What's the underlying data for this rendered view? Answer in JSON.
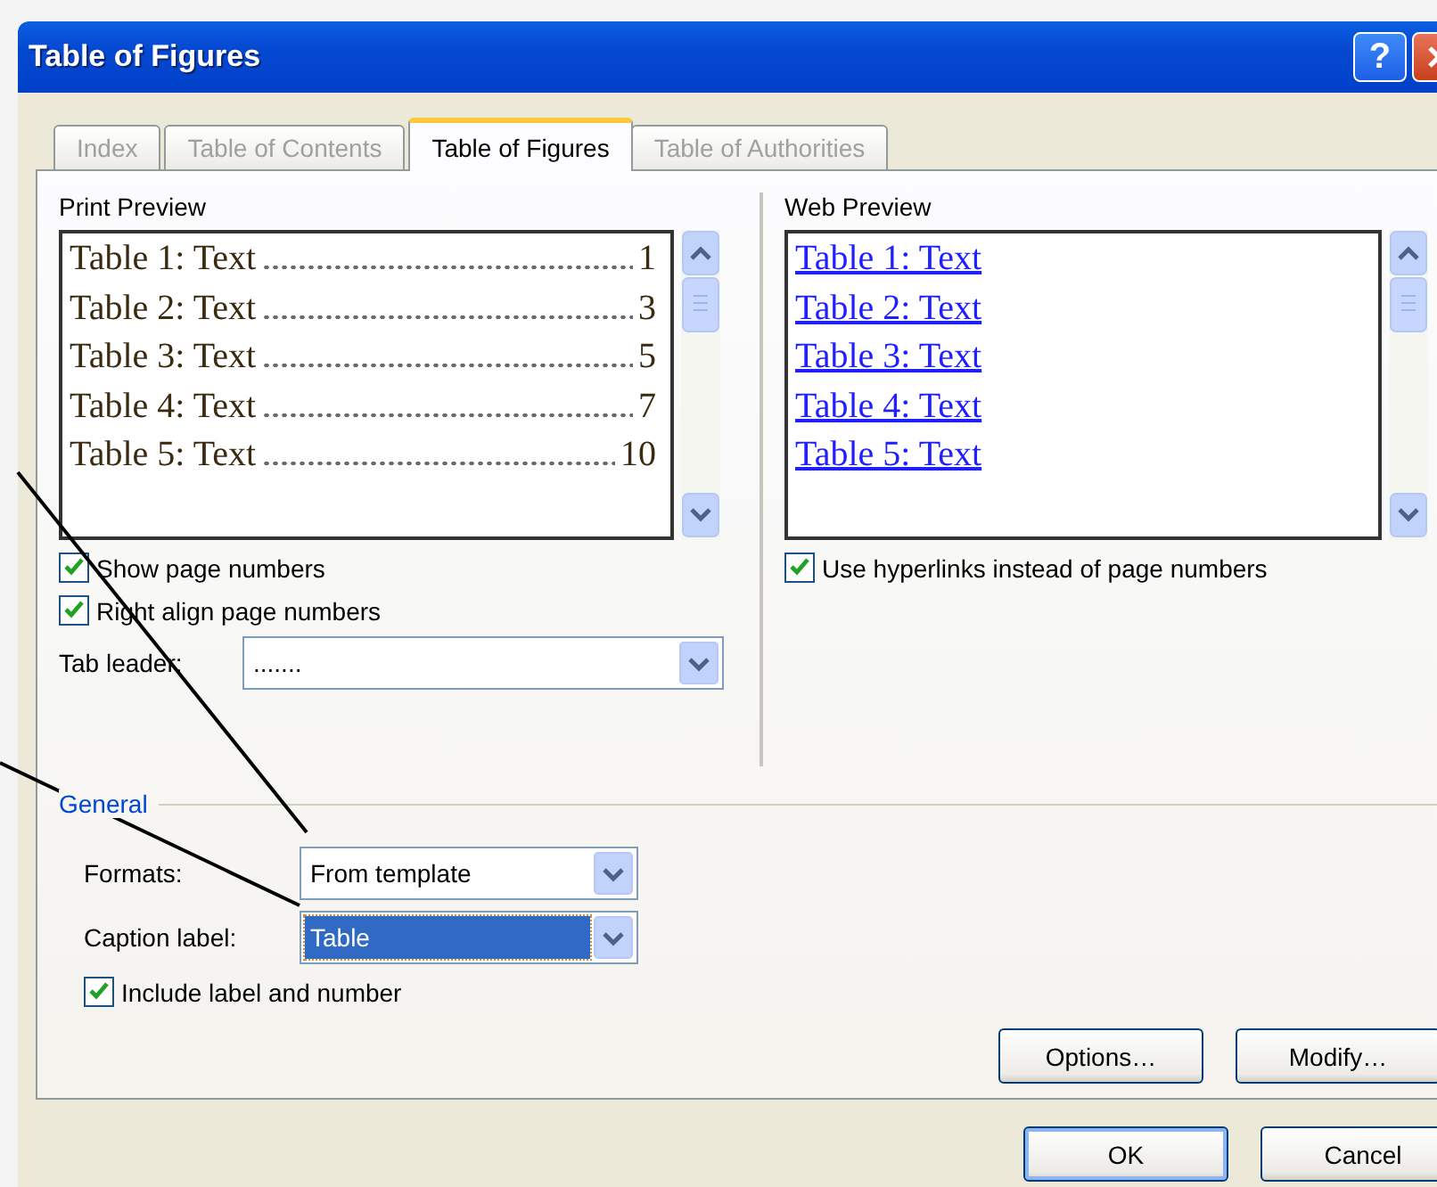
{
  "window": {
    "title": "Table of Figures",
    "help": "?"
  },
  "tabs": [
    {
      "label": "Index",
      "selected": false
    },
    {
      "label": "Table of Contents",
      "selected": false
    },
    {
      "label": "Table of Figures",
      "selected": true
    },
    {
      "label": "Table of Authorities",
      "selected": false
    }
  ],
  "print_preview": {
    "label": "Print Preview",
    "entries": [
      {
        "text": "Table 1: Text",
        "page": "1"
      },
      {
        "text": "Table 2: Text",
        "page": "3"
      },
      {
        "text": "Table 3: Text",
        "page": "5"
      },
      {
        "text": "Table 4: Text",
        "page": "7"
      },
      {
        "text": "Table 5: Text",
        "page": "10"
      }
    ]
  },
  "print_options": [
    {
      "label": "Show page numbers",
      "checked": true
    },
    {
      "label": "Right align page numbers",
      "checked": true
    }
  ],
  "tab_leader": {
    "label": "Tab leader:",
    "value": "......."
  },
  "web_preview": {
    "label": "Web Preview",
    "entries": [
      "Table 1: Text",
      "Table 2: Text",
      "Table 3: Text",
      "Table 4: Text",
      "Table 5: Text"
    ]
  },
  "web_options": [
    {
      "label": "Use hyperlinks instead of page numbers",
      "checked": true
    }
  ],
  "general": {
    "title": "General",
    "formats": {
      "label": "Formats:",
      "value": "From template",
      "selected": false
    },
    "caption_label": {
      "label": "Caption label:",
      "value": "Table",
      "selected": true
    },
    "include": {
      "label": "Include label and number",
      "checked": true
    }
  },
  "panel_buttons": [
    "Options…",
    "Modify…"
  ],
  "dialog_buttons": [
    {
      "label": "OK",
      "default": true
    },
    {
      "label": "Cancel",
      "default": false
    }
  ]
}
